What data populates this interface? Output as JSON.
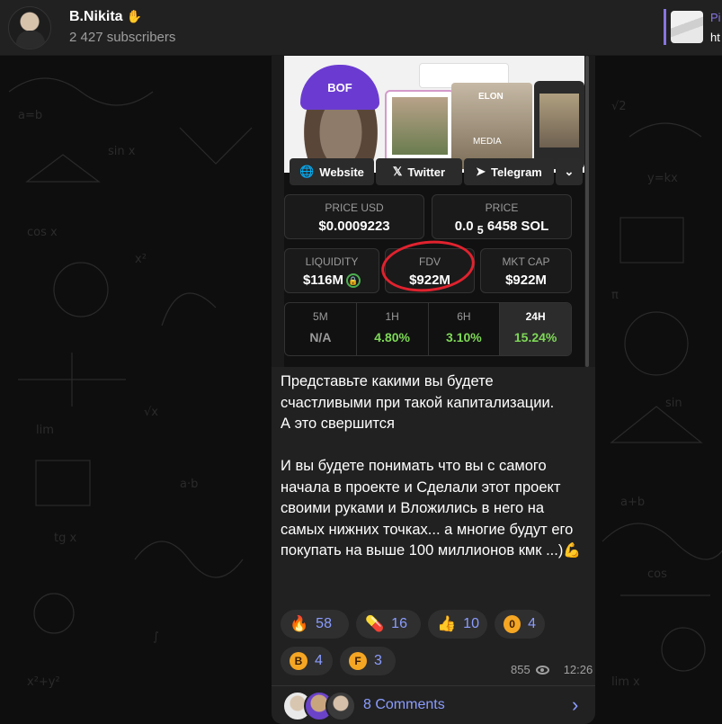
{
  "header": {
    "channel_name": "B.Nikita",
    "subscribers": "2 427 subscribers",
    "pinned_title": "Pi",
    "pinned_text": "ht"
  },
  "screenshot": {
    "beanie_text": "BOF",
    "card_text_top": "ELON",
    "card_text_bottom": "MEDIA",
    "links": [
      "Website",
      "Twitter",
      "Telegram"
    ],
    "price_usd": {
      "label": "PRICE USD",
      "value": "$0.0009223"
    },
    "price_sol": {
      "label": "PRICE",
      "value_prefix": "0.0",
      "value_sub": "5",
      "value_rest": "6458 SOL"
    },
    "liquidity": {
      "label": "LIQUIDITY",
      "value": "$116M"
    },
    "fdv": {
      "label": "FDV",
      "value": "$922M"
    },
    "mkt_cap": {
      "label": "MKT CAP",
      "value": "$922M"
    },
    "timeframes": [
      {
        "label": "5M",
        "value": "N/A",
        "color": "#9a9a9a"
      },
      {
        "label": "1H",
        "value": "4.80%",
        "color": "#7ed957"
      },
      {
        "label": "6H",
        "value": "3.10%",
        "color": "#7ed957"
      },
      {
        "label": "24H",
        "value": "15.24%",
        "color": "#7ed957"
      }
    ]
  },
  "message": {
    "text": "Представьте какими вы будете счастливыми при такой капитализации.\nА это свершится\n\nИ вы будете понимать что вы с самого начала в проекте и Сделали этот проект своими руками и Вложились в него на самых нижних точках... а многие будут его покупать на выше 100 миллионов кмк ...)",
    "emoji_end": "💪",
    "views": "855",
    "time": "12:26"
  },
  "reactions": [
    {
      "emoji": "🔥",
      "count": "58"
    },
    {
      "emoji": "💊",
      "count": "16"
    },
    {
      "emoji": "👍",
      "count": "10"
    },
    {
      "emoji": "0",
      "count": "4"
    },
    {
      "emoji": "B",
      "count": "4"
    },
    {
      "emoji": "F",
      "count": "3"
    }
  ],
  "comments": {
    "label": "8 Comments"
  },
  "colors": {
    "accent": "#8b9dff",
    "positive": "#7ed957",
    "highlight_circle": "#e0222e"
  }
}
